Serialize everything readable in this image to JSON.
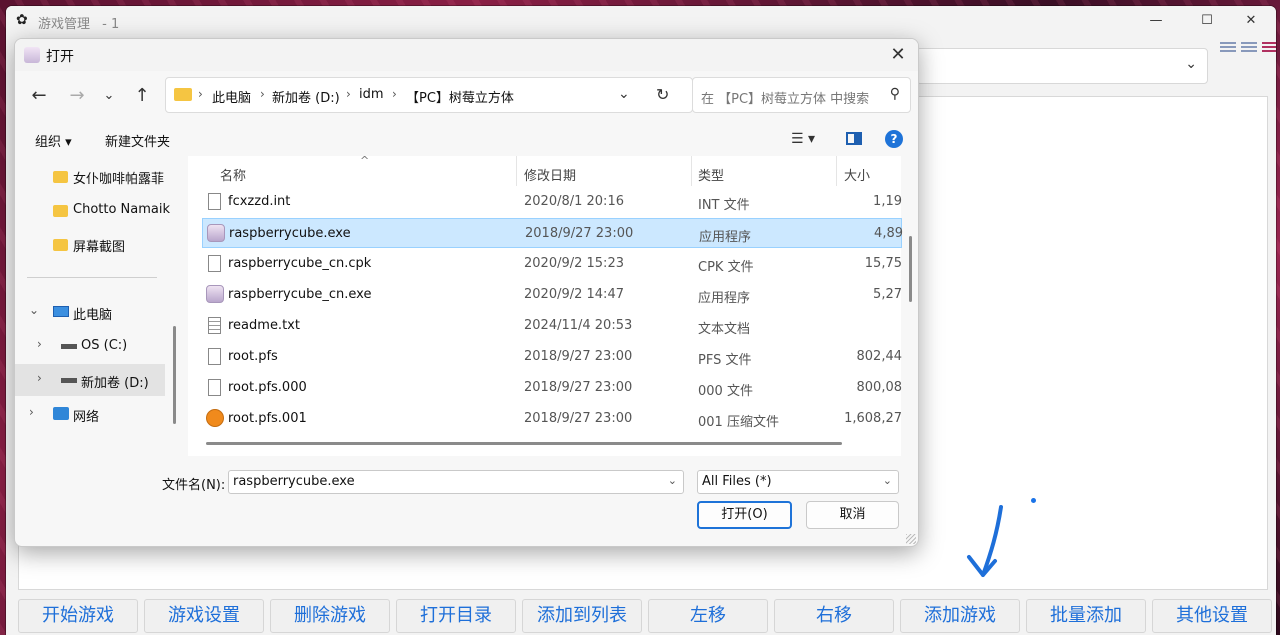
{
  "app": {
    "title": "游戏管理",
    "title_suffix": "- 1",
    "window_controls": {
      "minimize": "—",
      "maximize": "☐",
      "close": "✕"
    },
    "bottom_buttons": [
      "开始游戏",
      "游戏设置",
      "删除游戏",
      "打开目录",
      "添加到列表",
      "左移",
      "右移",
      "添加游戏",
      "批量添加",
      "其他设置"
    ],
    "accent_color": "#1e6fd9"
  },
  "dialog": {
    "title": "打开",
    "close_label": "✕",
    "address": {
      "crumbs": [
        "此电脑",
        "新加卷 (D:)",
        "idm",
        "【PC】树莓立方体"
      ],
      "separator": "›"
    },
    "search": {
      "placeholder": "在 【PC】树莓立方体 中搜索"
    },
    "toolbar": {
      "organize": "组织 ▾",
      "new_folder": "新建文件夹",
      "help": "?"
    },
    "left_nav": {
      "quick_access": [
        "女仆咖啡帕露菲",
        "Chotto Namaik",
        "屏幕截图"
      ],
      "this_pc": "此电脑",
      "drives": [
        "OS (C:)",
        "新加卷 (D:)"
      ],
      "network": "网络"
    },
    "columns": {
      "name": "名称",
      "date": "修改日期",
      "type": "类型",
      "size": "大小"
    },
    "files": [
      {
        "name": "fcxzzd.int",
        "date": "2020/8/1 20:16",
        "type": "INT 文件",
        "size": "1,19",
        "icon": "document-icon"
      },
      {
        "name": "raspberrycube.exe",
        "date": "2018/9/27 23:00",
        "type": "应用程序",
        "size": "4,89",
        "icon": "exe-icon",
        "selected": true
      },
      {
        "name": "raspberrycube_cn.cpk",
        "date": "2020/9/2 15:23",
        "type": "CPK 文件",
        "size": "15,75",
        "icon": "document-icon"
      },
      {
        "name": "raspberrycube_cn.exe",
        "date": "2020/9/2 14:47",
        "type": "应用程序",
        "size": "5,27",
        "icon": "exe-icon"
      },
      {
        "name": "readme.txt",
        "date": "2024/11/4 20:53",
        "type": "文本文档",
        "size": "",
        "icon": "text-icon"
      },
      {
        "name": "root.pfs",
        "date": "2018/9/27 23:00",
        "type": "PFS 文件",
        "size": "802,44",
        "icon": "document-icon"
      },
      {
        "name": "root.pfs.000",
        "date": "2018/9/27 23:00",
        "type": "000 文件",
        "size": "800,08",
        "icon": "document-icon"
      },
      {
        "name": "root.pfs.001",
        "date": "2018/9/27 23:00",
        "type": "001 压缩文件",
        "size": "1,608,27",
        "icon": "archive-icon"
      }
    ],
    "filename_label": "文件名(N):",
    "filename_value": "raspberrycube.exe",
    "filetype_value": "All Files (*)",
    "open_button": "打开(O)",
    "cancel_button": "取消",
    "selection_color": "#cce8ff"
  }
}
